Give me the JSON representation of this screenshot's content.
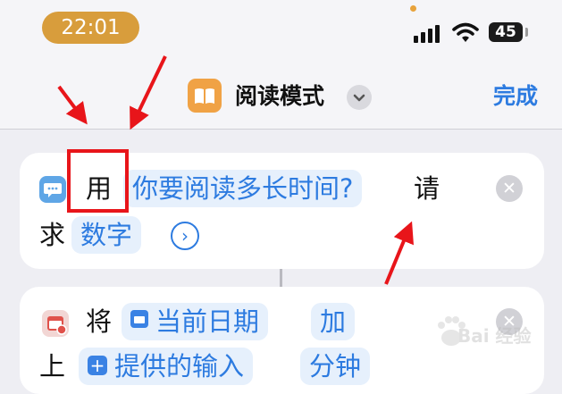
{
  "status_bar": {
    "time": "22:01",
    "battery": "45",
    "icons": [
      "cellular-signal-icon",
      "wifi-icon",
      "battery-icon"
    ]
  },
  "nav": {
    "app_icon": "book-icon",
    "title": "阅读模式",
    "chevron_icon": "chevron-down-icon",
    "done_label": "完成"
  },
  "action1": {
    "icon": "ask-input-icon",
    "word_use": "用",
    "prompt": "你要阅读多长时间?",
    "word_request": "请",
    "word_qiu": "求",
    "type": "数字",
    "expand_icon": "chevron-right-circle-icon",
    "close_icon": "close-icon"
  },
  "action2": {
    "icon": "date-icon",
    "word_jiang": "将",
    "current_date": "当前日期",
    "word_add": "加",
    "word_up": "上",
    "provided_input": "提供的输入",
    "unit": "分钟",
    "close_icon": "close-icon"
  },
  "watermark": {
    "logo": "baidu-paw-icon",
    "text": "Bai 经验"
  },
  "colors": {
    "accent": "#2d7be0",
    "time_pill": "#d89d3c",
    "app_icon": "#f0a245",
    "annotation_red": "#e8151a"
  }
}
